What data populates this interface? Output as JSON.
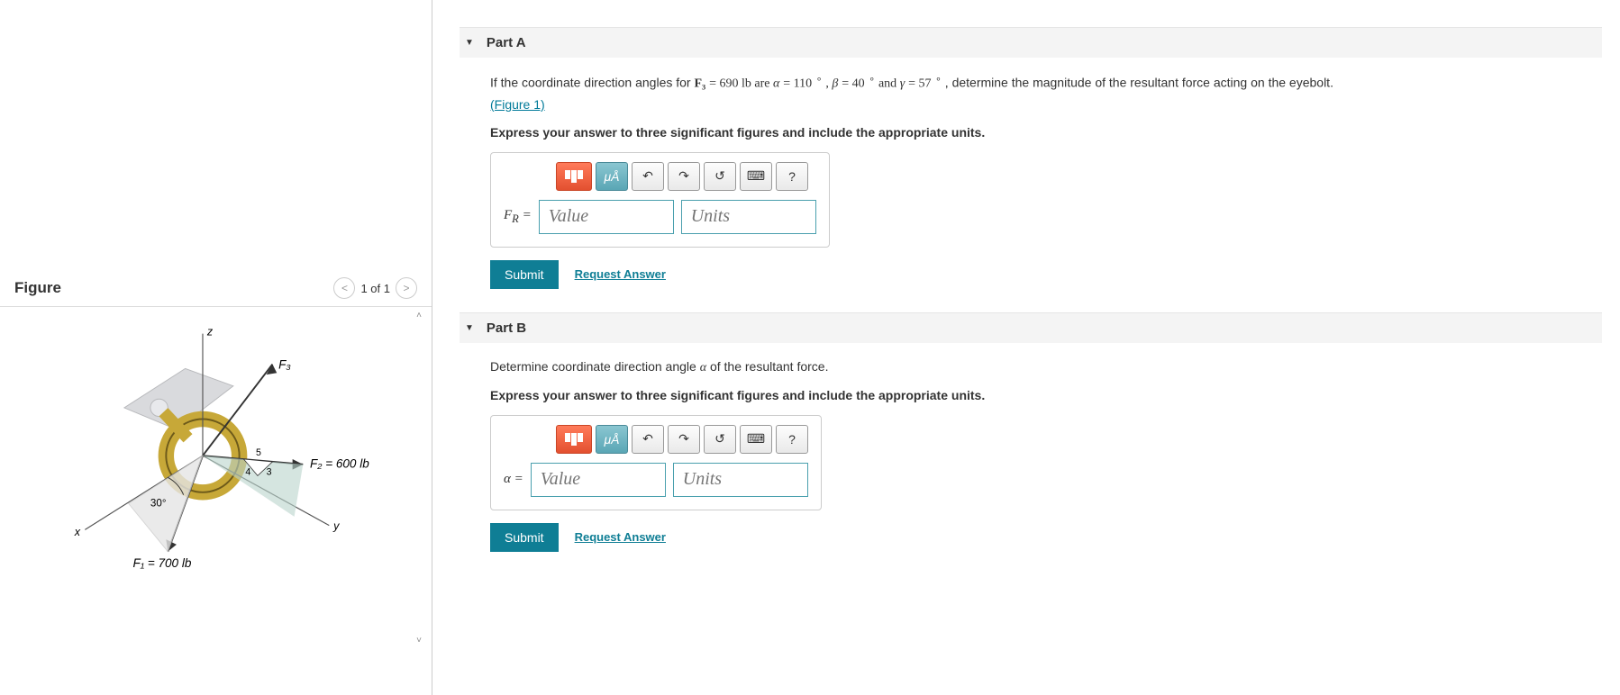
{
  "figure": {
    "title": "Figure",
    "counter": "1 of 1",
    "labels": {
      "z": "z",
      "x": "x",
      "y": "y",
      "F3": "F₃",
      "F2": "F₂ = 600 lb",
      "F1": "F₁ = 700 lb",
      "angle30": "30°",
      "tri_hyp": "5",
      "tri_adj": "4",
      "tri_opp": "3"
    }
  },
  "partA": {
    "header": "Part A",
    "q_pre": "If the coordinate direction angles for ",
    "q_F3": "F₃",
    "q_F3val": " = 690 lb are ",
    "q_alpha": "α",
    "q_alphaVal": " = 110 ",
    "q_beta": "β",
    "q_betaVal": " = 40 ",
    "q_gamma": "γ",
    "q_gammaVal": " = 57 ",
    "q_and1": " , ",
    "q_and2": "  and ",
    "q_post": ", determine the magnitude of the resultant force acting on the eyebolt.",
    "figLink": "(Figure 1)",
    "instruction": "Express your answer to three significant figures and include the appropriate units.",
    "varLabelHTML": "F_R =",
    "varLabel": "F",
    "varSub": "R",
    "valuePH": "Value",
    "unitsPH": "Units",
    "submit": "Submit",
    "request": "Request Answer"
  },
  "partB": {
    "header": "Part B",
    "q": "Determine coordinate direction angle ",
    "q_alpha": "α",
    "q_post": " of the resultant force.",
    "instruction": "Express your answer to three significant figures and include the appropriate units.",
    "varLabel": "α =",
    "valuePH": "Value",
    "unitsPH": "Units",
    "submit": "Submit",
    "request": "Request Answer"
  },
  "toolbar": {
    "templates": "templates",
    "mu": "μÅ",
    "undo": "↶",
    "redo": "↷",
    "reset": "↺",
    "keyboard": "⌨",
    "help": "?"
  },
  "deg": "∘"
}
